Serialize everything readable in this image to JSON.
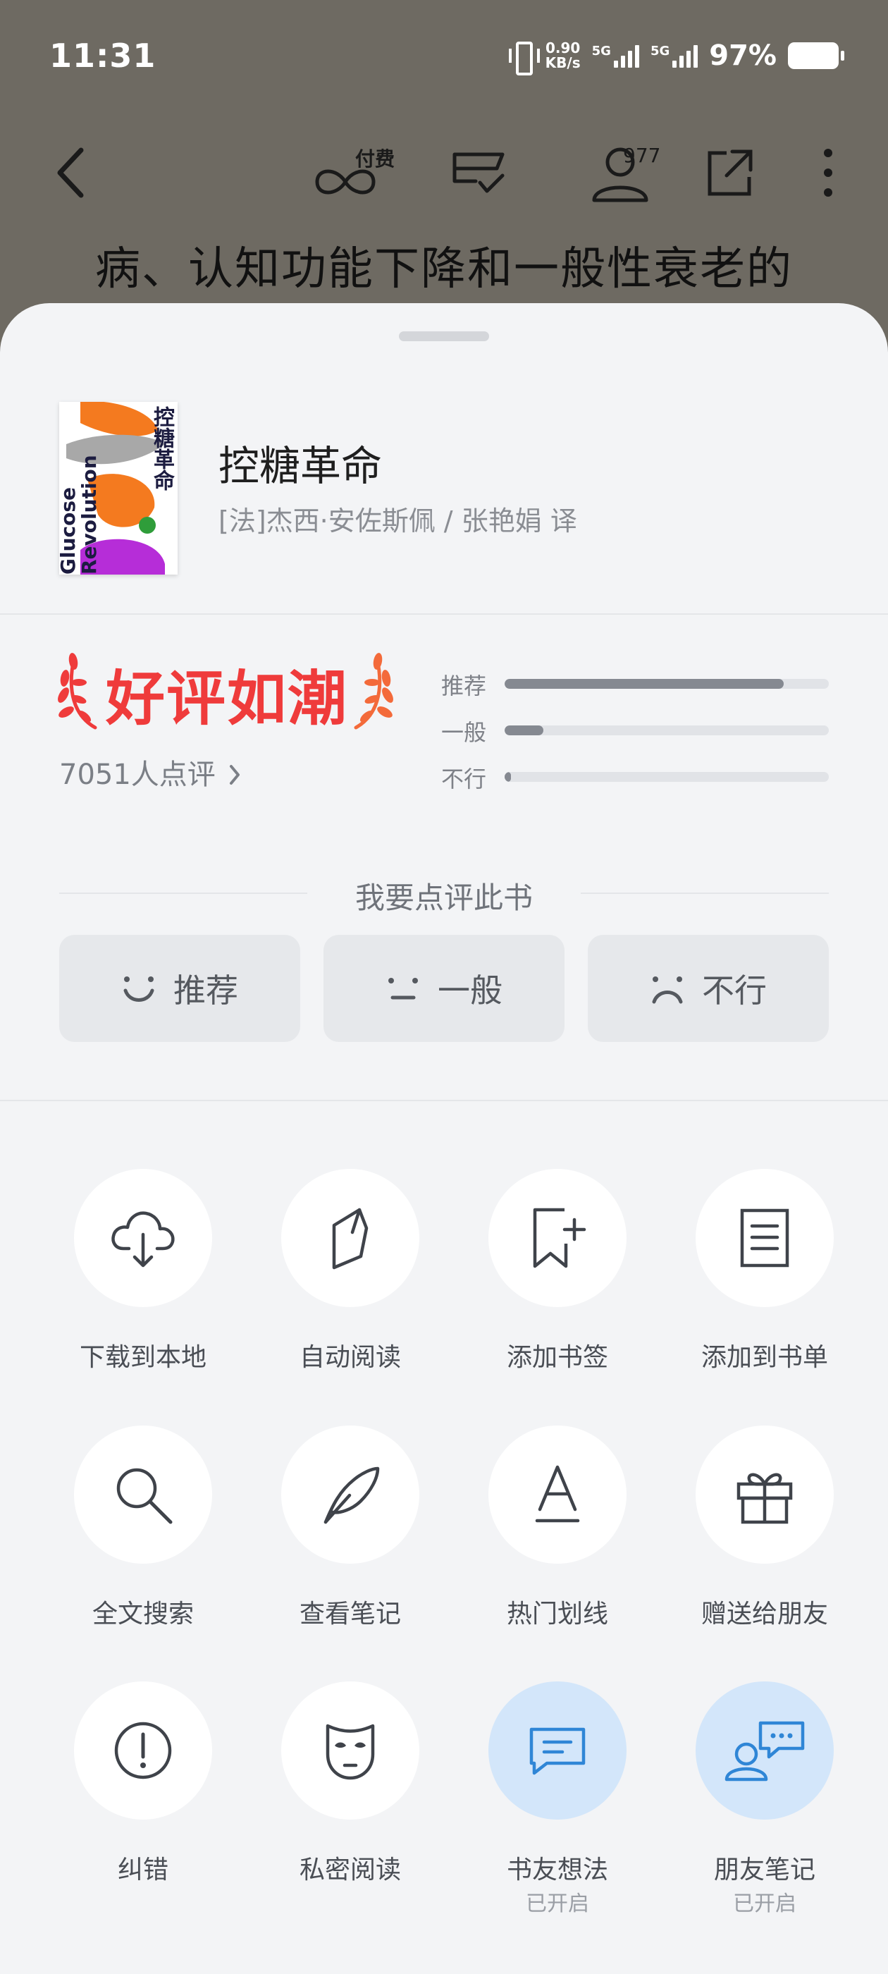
{
  "status_bar": {
    "time": "11:31",
    "net_speed_value": "0.90",
    "net_speed_unit": "KB/s",
    "sim1_label": "5G",
    "sim2_label": "5G",
    "battery_pct": "97%"
  },
  "reader_toolbar": {
    "pay_label": "付费",
    "readers_count": "977"
  },
  "reader_text": "病、认知功能下降和一般性衰老的",
  "book": {
    "title": "控糖革命",
    "author_line": "[法]杰西·安佐斯佩 / 张艳娟  译",
    "cover_title_cn": "控糖革命",
    "cover_title_en1": "Glucose",
    "cover_title_en2": "Revolution"
  },
  "rating": {
    "badge_text": "好评如潮",
    "review_count": "7051人点评",
    "bars": [
      {
        "label": "推荐",
        "fraction": 0.86
      },
      {
        "label": "一般",
        "fraction": 0.12
      },
      {
        "label": "不行",
        "fraction": 0.02
      }
    ],
    "prompt": "我要点评此书",
    "buttons": [
      {
        "label": "推荐",
        "icon": "smile-icon"
      },
      {
        "label": "一般",
        "icon": "neutral-face-icon"
      },
      {
        "label": "不行",
        "icon": "frown-icon"
      }
    ]
  },
  "actions": [
    {
      "label": "下载到本地",
      "icon": "cloud-download-icon"
    },
    {
      "label": "自动阅读",
      "icon": "auto-read-icon"
    },
    {
      "label": "添加书签",
      "icon": "bookmark-add-icon"
    },
    {
      "label": "添加到书单",
      "icon": "booklist-icon"
    },
    {
      "label": "全文搜索",
      "icon": "search-icon"
    },
    {
      "label": "查看笔记",
      "icon": "feather-icon"
    },
    {
      "label": "热门划线",
      "icon": "underline-a-icon"
    },
    {
      "label": "赠送给朋友",
      "icon": "gift-icon"
    },
    {
      "label": "纠错",
      "icon": "alert-circle-icon"
    },
    {
      "label": "私密阅读",
      "icon": "mask-icon"
    },
    {
      "label": "书友想法",
      "sub": "已开启",
      "icon": "chat-bubble-icon",
      "active": true
    },
    {
      "label": "朋友笔记",
      "sub": "已开启",
      "icon": "friends-chat-icon",
      "active": true
    }
  ],
  "colors": {
    "accent_red": "#ef3b3b",
    "active_circle": "#d3e6fa",
    "active_icon": "#2f86d6"
  }
}
